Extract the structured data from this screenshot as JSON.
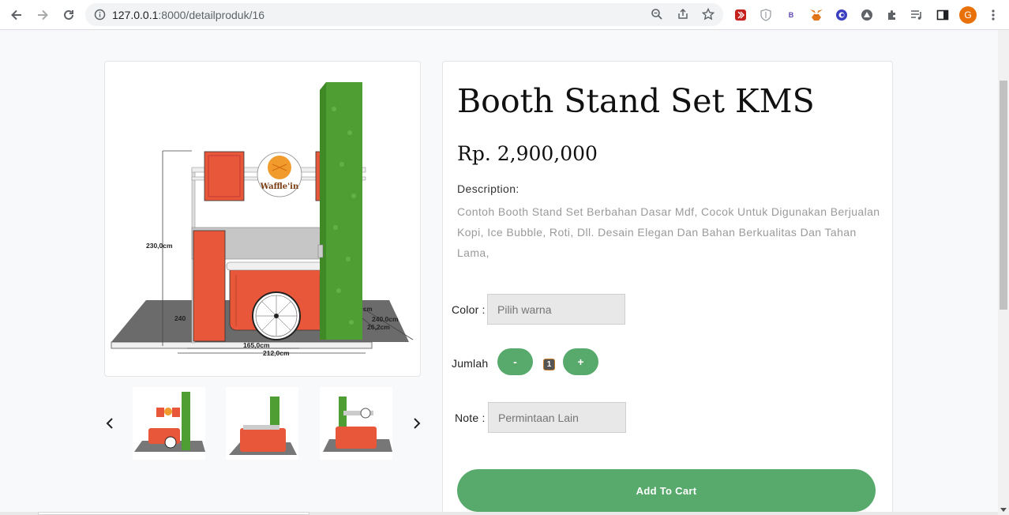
{
  "browser": {
    "url_host": "127.0.0.1",
    "url_path": ":8000/detailproduk/16",
    "profile_initial": "G",
    "icons": [
      "back-arrow-icon",
      "forward-arrow-icon",
      "reload-icon",
      "site-info-icon",
      "zoom-icon",
      "share-icon",
      "bookmark-star-icon",
      "extension-red-icon",
      "extension-shield-icon",
      "extension-b-icon",
      "metamask-fox-icon",
      "extension-circle-icon",
      "extension-diamond-icon",
      "extensions-puzzle-icon",
      "media-queue-icon",
      "side-panel-icon",
      "kebab-menu-icon"
    ]
  },
  "product": {
    "title": "Booth Stand Set KMS",
    "price": "Rp. 2,900,000",
    "description_label": "Description:",
    "description": "Contoh Booth Stand Set Berbahan Dasar Mdf, Cocok Untuk Digunakan Berjualan Kopi, Ice Bubble, Roti, Dll. Desain Elegan Dan Bahan Berkualitas Dan Tahan Lama,",
    "main_image": "booth-stand-waffle-cart-drawing",
    "image_labels": {
      "brand": "Waffle'in",
      "height": "230,0cm",
      "side": "240",
      "depth_a": "240.0cm",
      "depth_b": "26,2cm",
      "short_cm": "cm",
      "width_inner": "165,0cm",
      "width_outer": "212,0cm"
    },
    "thumbnails": [
      "booth-front-thumb",
      "booth-side-thumb",
      "booth-back-thumb"
    ]
  },
  "form": {
    "color_label": "Color :",
    "color_placeholder": "Pilih warna",
    "qty_label": "Jumlah",
    "qty_minus": "-",
    "qty_value": "1",
    "qty_plus": "+",
    "note_label": "Note :",
    "note_placeholder": "Permintaan Lain",
    "add_to_cart": "Add To Cart"
  },
  "colors": {
    "accent_green": "#57a96c",
    "booth_orange": "#e8573a",
    "wall_green": "#4a9a2e"
  }
}
